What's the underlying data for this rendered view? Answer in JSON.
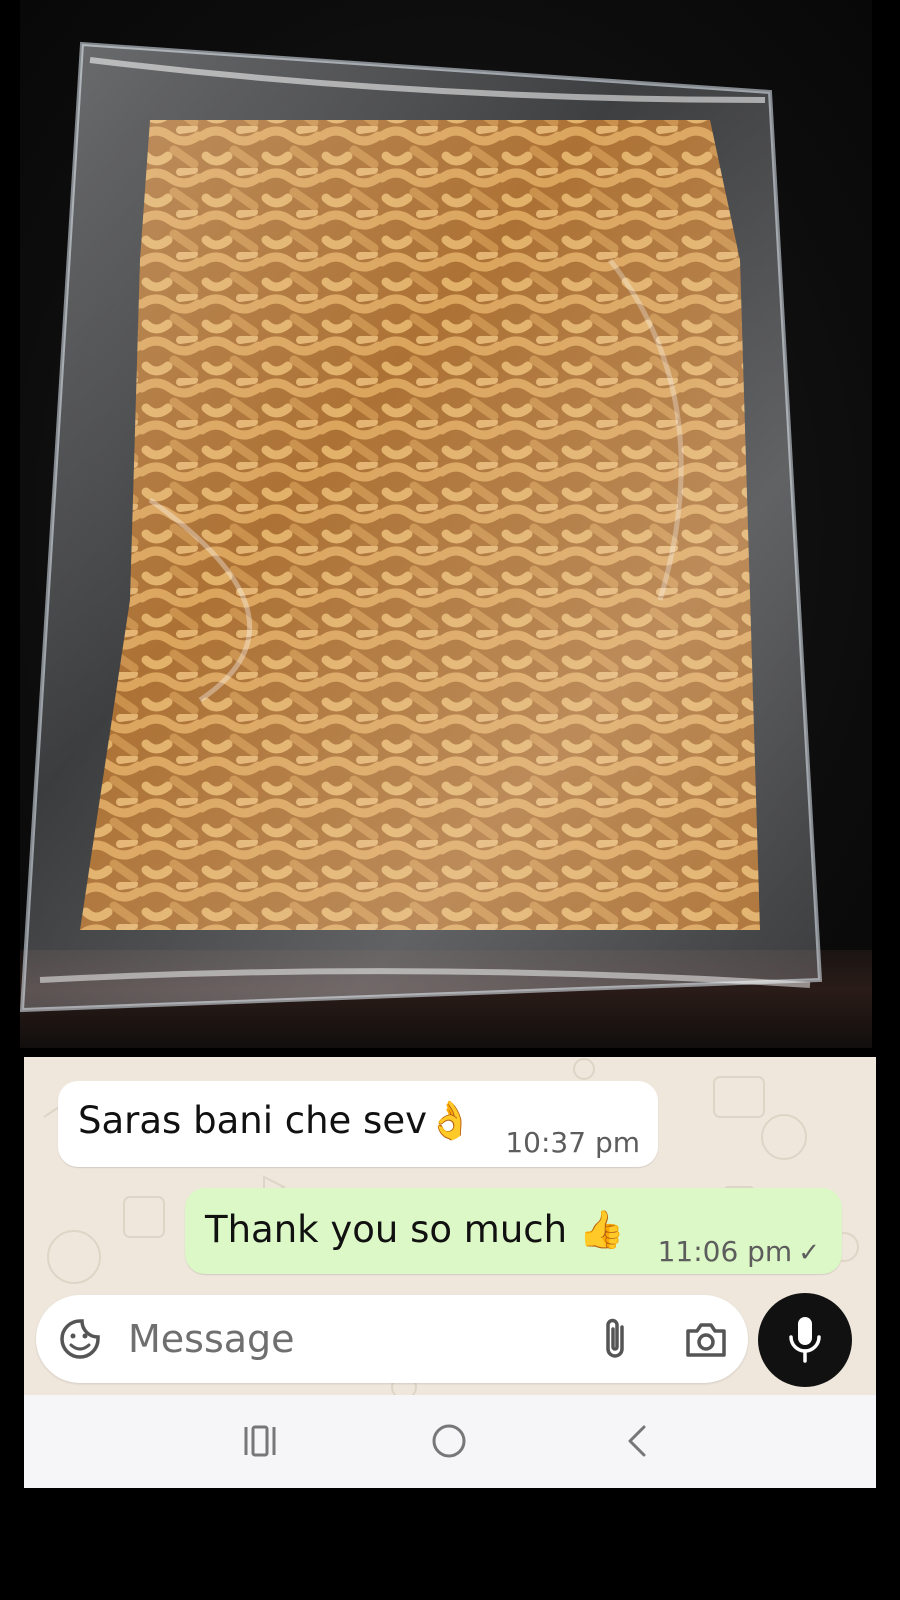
{
  "photo": {
    "icon": "food-photo",
    "colors": {
      "background": "#0d0d0d",
      "food": "#c98a3e"
    }
  },
  "chat": {
    "messages": [
      {
        "direction": "incoming",
        "text": "Saras bani che sev👌",
        "time": "10:37 pm"
      },
      {
        "direction": "outgoing",
        "text": "Thank you so much 👍",
        "time": "11:06 pm",
        "status": "✓"
      }
    ],
    "colors": {
      "incoming": "#ffffff",
      "outgoing": "#dcf8c6",
      "wallpaper": "#efe7dc"
    }
  },
  "composer": {
    "placeholder": "Message",
    "icons": [
      "sticker-icon",
      "attach-icon",
      "camera-icon",
      "mic-icon"
    ]
  },
  "navbar": {
    "icons": [
      "recents-icon",
      "home-icon",
      "back-icon"
    ]
  }
}
